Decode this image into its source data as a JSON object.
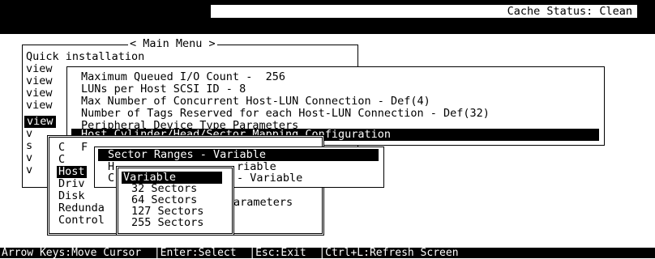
{
  "header": {
    "cache_status": "Cache Status: Clean"
  },
  "main_menu": {
    "title": "< Main Menu >",
    "items": [
      "Quick installation",
      "view",
      "view",
      "view",
      "view",
      "view",
      "v",
      "s",
      "v",
      "v"
    ],
    "selected_index": 5
  },
  "host_params": {
    "items": [
      "Maximum Queued I/O Count -  256",
      "LUNs per Host SCSI ID - 8",
      "Max Number of Concurrent Host-LUN Connection - Def(4)",
      "Number of Tags Reserved for each Host-LUN Connection - Def(32)",
      "Peripheral Device Type Parameters",
      "Host Cylinder/Head/Sector Mapping Configuration"
    ],
    "selected_index": 5
  },
  "config_menu": {
    "items": [
      "C",
      "C",
      "Host",
      "Driv",
      "Disk",
      "Redunda",
      "Control"
    ],
    "tail": [
      "F",
      "",
      "",
      "",
      "",
      "arameters",
      ""
    ],
    "highlighted_index": 2
  },
  "chs_menu": {
    "items": [
      "Sector Ranges - Variable",
      "H",
      "C"
    ],
    "tails": [
      "",
      "riable",
      "- Variable"
    ],
    "selected_index": 0
  },
  "sector_options": {
    "items": [
      "Variable",
      "32 Sectors",
      "64 Sectors",
      "127 Sectors",
      "255 Sectors"
    ],
    "selected_index": 0
  },
  "status_bar": {
    "help": "Arrow Keys:Move Cursor  |Enter:Select  |Esc:Exit  |Ctrl+L:Refresh Screen"
  }
}
